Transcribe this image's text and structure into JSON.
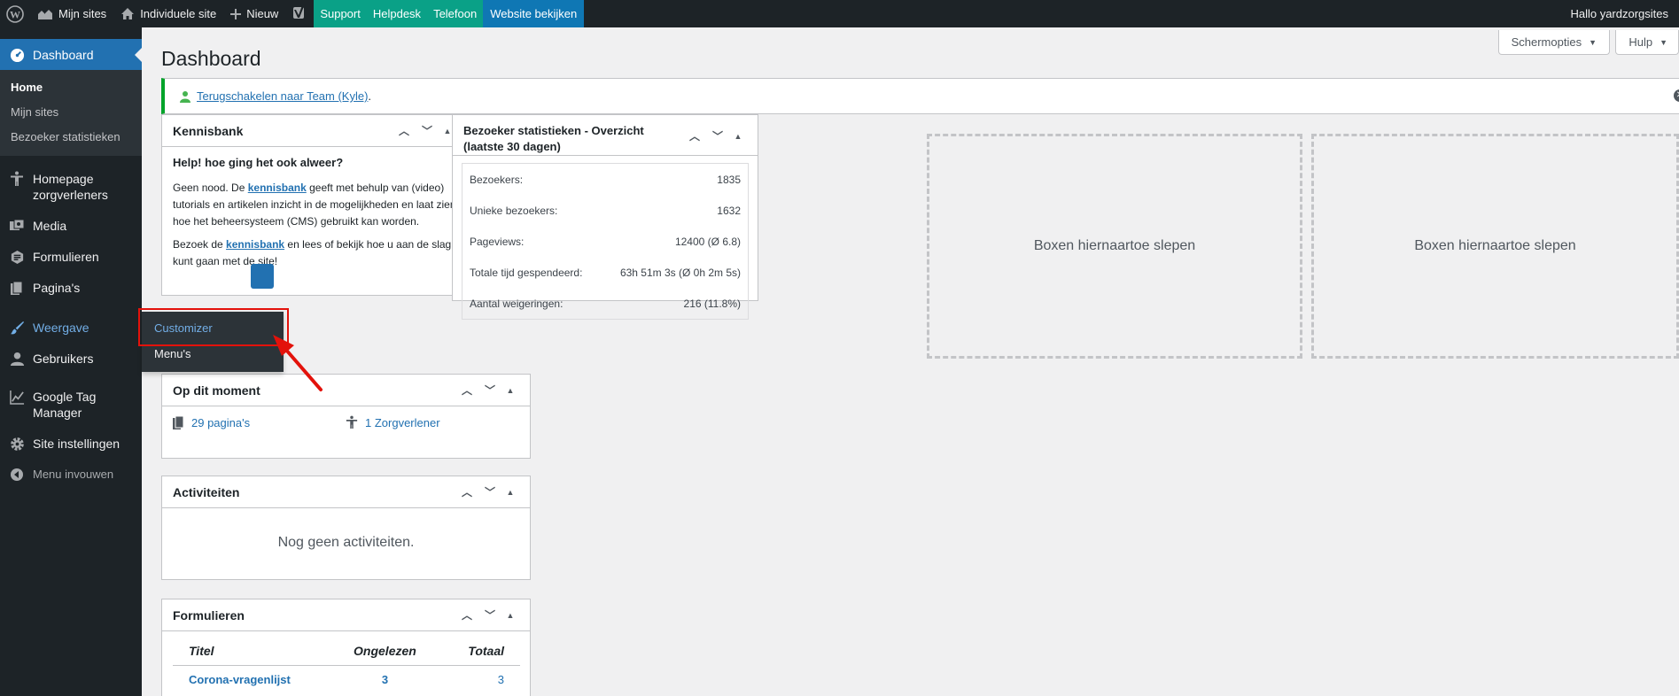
{
  "adminbar": {
    "wp_logo": "wordpress-icon",
    "my_sites": "Mijn sites",
    "site_name": "Individuele site",
    "new": "Nieuw",
    "seo_icon": "yoast-icon",
    "support": "Support",
    "helpdesk": "Helpdesk",
    "telefoon": "Telefoon",
    "view_site": "Website bekijken",
    "greeting": "Hallo yardzorgsites"
  },
  "sidebar": {
    "dashboard": "Dashboard",
    "submenu": [
      "Home",
      "Mijn sites",
      "Bezoeker statistieken"
    ],
    "items": [
      "Homepage zorgverleners",
      "Media",
      "Formulieren",
      "Pagina's",
      "Weergave",
      "Gebruikers",
      "Google Tag Manager",
      "Site instellingen",
      "Menu invouwen"
    ]
  },
  "flyout": [
    "Customizer",
    "Menu's"
  ],
  "header": {
    "title": "Dashboard",
    "screen_options": "Schermopties",
    "help": "Hulp"
  },
  "notice": {
    "link": "Terugschakelen naar Team (Kyle)",
    "suffix": "."
  },
  "kennisbank": {
    "title": "Kennisbank",
    "heading": "Help! hoe ging het ook alweer?",
    "p1_before": "Geen nood. De ",
    "p1_link": "kennisbank",
    "p1_after": " geeft met behulp van (video) tutorials en artikelen inzicht in de mogelijkheden en laat zien hoe het beheersysteem (CMS) gebruikt kan worden.",
    "p2_before": "Bezoek de ",
    "p2_link": "kennisbank",
    "p2_after": " en lees of bekijk hoe u aan de slag kunt gaan met de site!"
  },
  "stats": {
    "title": "Bezoeker statistieken - Overzicht (laatste 30 dagen)",
    "rows": [
      {
        "label": "Bezoekers:",
        "value": "1835"
      },
      {
        "label": "Unieke bezoekers:",
        "value": "1632"
      },
      {
        "label": "Pageviews:",
        "value": "12400 (Ø 6.8)"
      },
      {
        "label": "Totale tijd gespendeerd:",
        "value": "63h 51m 3s (Ø 0h 2m 5s)"
      },
      {
        "label": "Aantal weigeringen:",
        "value": "216 (11.8%)"
      }
    ]
  },
  "dropzones": [
    "Boxen hiernaartoe slepen",
    "Boxen hiernaartoe slepen"
  ],
  "glance": {
    "title": "Op dit moment",
    "pages": "29 pagina's",
    "providers": "1 Zorgverlener"
  },
  "activity": {
    "title": "Activiteiten",
    "empty": "Nog geen activiteiten."
  },
  "forms": {
    "title": "Formulieren",
    "headers": [
      "Titel",
      "Ongelezen",
      "Totaal"
    ],
    "rows": [
      {
        "title": "Corona-vragenlijst",
        "unread": "3",
        "total": "3"
      }
    ]
  },
  "colors": {
    "accent": "#2271b1",
    "highlight": "#e3120b",
    "notice_border": "#00a32a"
  }
}
